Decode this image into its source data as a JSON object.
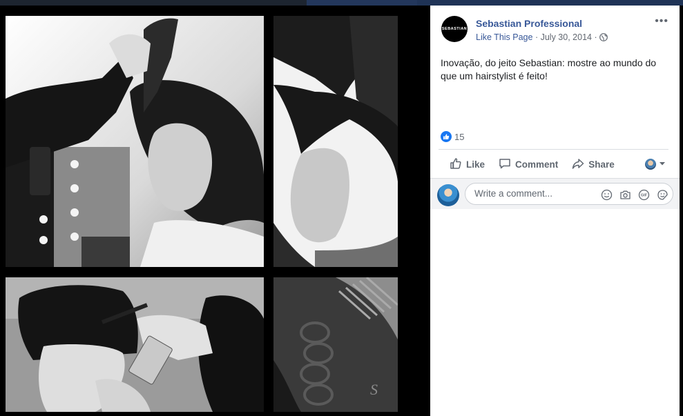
{
  "post": {
    "page_name": "Sebastian Professional",
    "avatar_text": "SEBASTIAN",
    "like_page": "Like This Page",
    "separator": "·",
    "date": "July 30, 2014",
    "more": "•••",
    "text": "Inovação, do jeito Sebastian: mostre ao mundo do que um hairstylist é feito!",
    "reaction_count": "15"
  },
  "actions": {
    "like": "Like",
    "comment": "Comment",
    "share": "Share"
  },
  "comment": {
    "placeholder": "Write a comment..."
  },
  "icons": {
    "globe": "globe-icon",
    "like": "thumbs-up-icon",
    "comment": "speech-bubble-icon",
    "share": "share-arrow-icon",
    "emoji": "emoji-icon",
    "camera": "camera-icon",
    "gif": "gif-icon",
    "sticker": "sticker-icon"
  },
  "colors": {
    "link": "#385898",
    "like_blue": "#1877f2",
    "muted": "#606770"
  }
}
